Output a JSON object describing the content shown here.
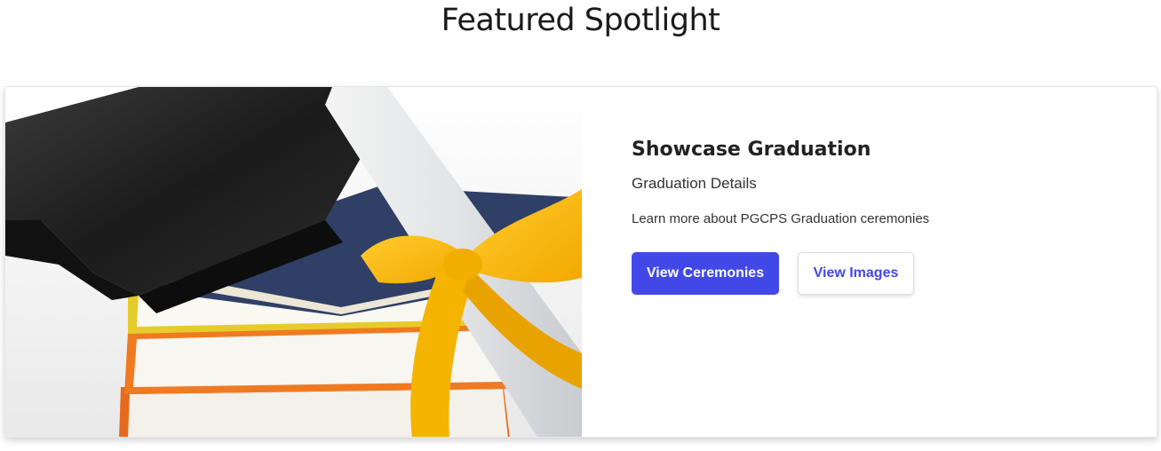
{
  "section": {
    "title": "Featured Spotlight"
  },
  "card": {
    "image_alt": "Graduation cap, stacked books and diploma tied with a yellow ribbon",
    "title": "Showcase Graduation",
    "subtitle": "Graduation Details",
    "description": "Learn more about PGCPS Graduation ceremonies",
    "primary_button": "View Ceremonies",
    "secondary_button": "View Images"
  },
  "colors": {
    "accent": "#4248e8",
    "text": "#222222"
  }
}
